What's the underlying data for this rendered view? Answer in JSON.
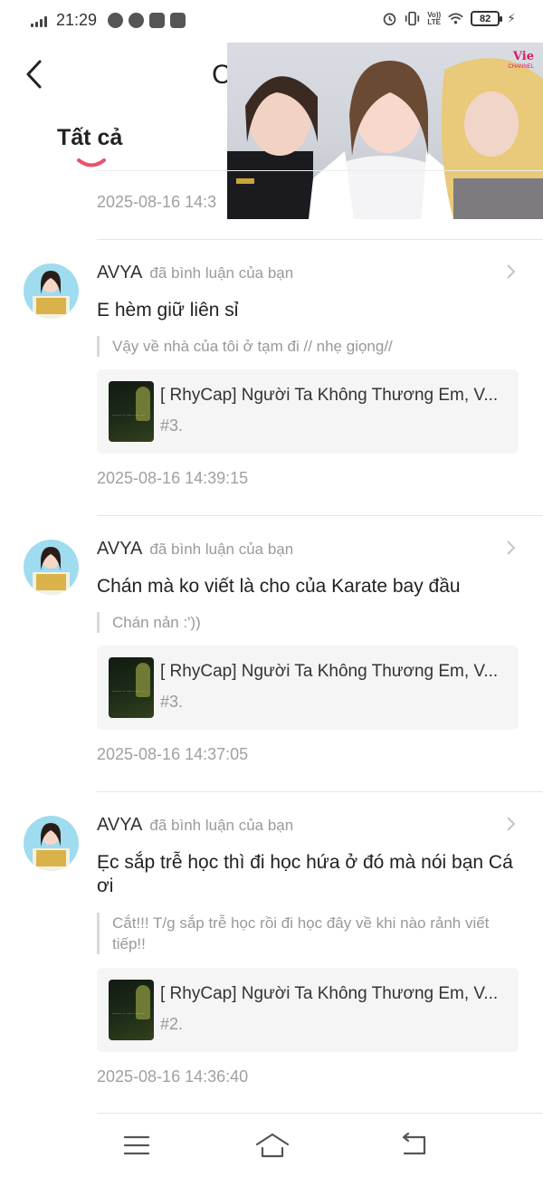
{
  "status_bar": {
    "time": "21:29",
    "battery": "82",
    "network": "VoLTE"
  },
  "header": {
    "title_visible": "C",
    "tab_all": "Tất cả"
  },
  "video_overlay": {
    "logo": "Vie",
    "logo_sub": "CHANNEL"
  },
  "partial_item": {
    "timestamp": "2025-08-16 14:3"
  },
  "notifications": [
    {
      "user": "AVYA",
      "action": "đã bình luận của bạn",
      "comment": "E hèm giữ liên sỉ",
      "quote": "Vậy về nhà của tôi ở tạm đi // nhẹ giọng//",
      "video_title": "[ RhyCap] Người Ta Không Thương Em, V...",
      "video_episode": "#3.",
      "timestamp": "2025-08-16 14:39:15"
    },
    {
      "user": "AVYA",
      "action": "đã bình luận của bạn",
      "comment": "Chán mà ko viết là cho của Karate bay đầu",
      "quote": "Chán nản :'))",
      "video_title": "[ RhyCap] Người Ta Không Thương Em, V...",
      "video_episode": "#3.",
      "timestamp": "2025-08-16 14:37:05"
    },
    {
      "user": "AVYA",
      "action": "đã bình luận của bạn",
      "comment": "Ẹc sắp trễ học thì đi học hứa ở đó mà nói bạn Cá ơi",
      "quote": "Cắt!!! T/g sắp trễ học rồi đi học đây về khi nào rảnh viết tiếp!!",
      "video_title": "[ RhyCap] Người Ta Không Thương Em, V...",
      "video_episode": "#2.",
      "timestamp": "2025-08-16 14:36:40"
    }
  ],
  "colors": {
    "accent": "#e8536b",
    "muted_text": "#999999",
    "card_bg": "#f5f5f5"
  }
}
